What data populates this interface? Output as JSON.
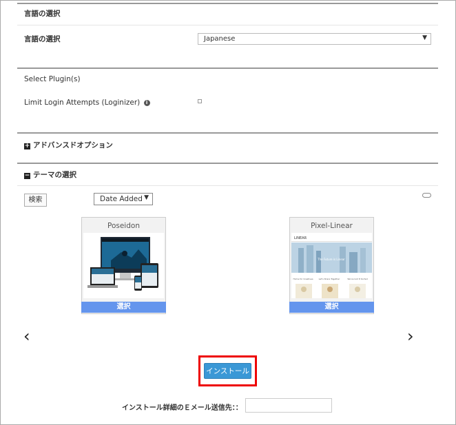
{
  "language_section": {
    "header": "言語の選択",
    "field_label": "言語の選択",
    "selected_value": "Japanese"
  },
  "plugins": {
    "header": "Select Plugin(s)",
    "limit_login_label": "Limit Login Attempts (Loginizer)",
    "info_icon": "info-icon",
    "limit_login_checked": false
  },
  "advanced": {
    "icon": "plus-square-icon",
    "label": "アドバンスドオプション"
  },
  "theme": {
    "icon": "minus-square-icon",
    "label": "テーマの選択",
    "search_button": "検索",
    "sort_selected": "Date Added",
    "cards": [
      {
        "title": "Poseidon",
        "select_label": "選択"
      },
      {
        "title": "Pixel-Linear",
        "select_label": "選択",
        "brand": "LINEAR",
        "hero_text": "The Future is Linear",
        "features": [
          "Home for Creatives",
          "Let's Share Together",
          "We've Got It Sorted"
        ]
      }
    ],
    "prev_icon": "chevron-left-icon",
    "next_icon": "chevron-right-icon"
  },
  "install": {
    "button_label": "インストール",
    "email_label": "インストール詳細のＥメール送信先：：",
    "email_value": ""
  },
  "colors": {
    "select_bar": "#6495ed",
    "install_button": "#3a98d6",
    "highlight_border": "#ee0000"
  }
}
